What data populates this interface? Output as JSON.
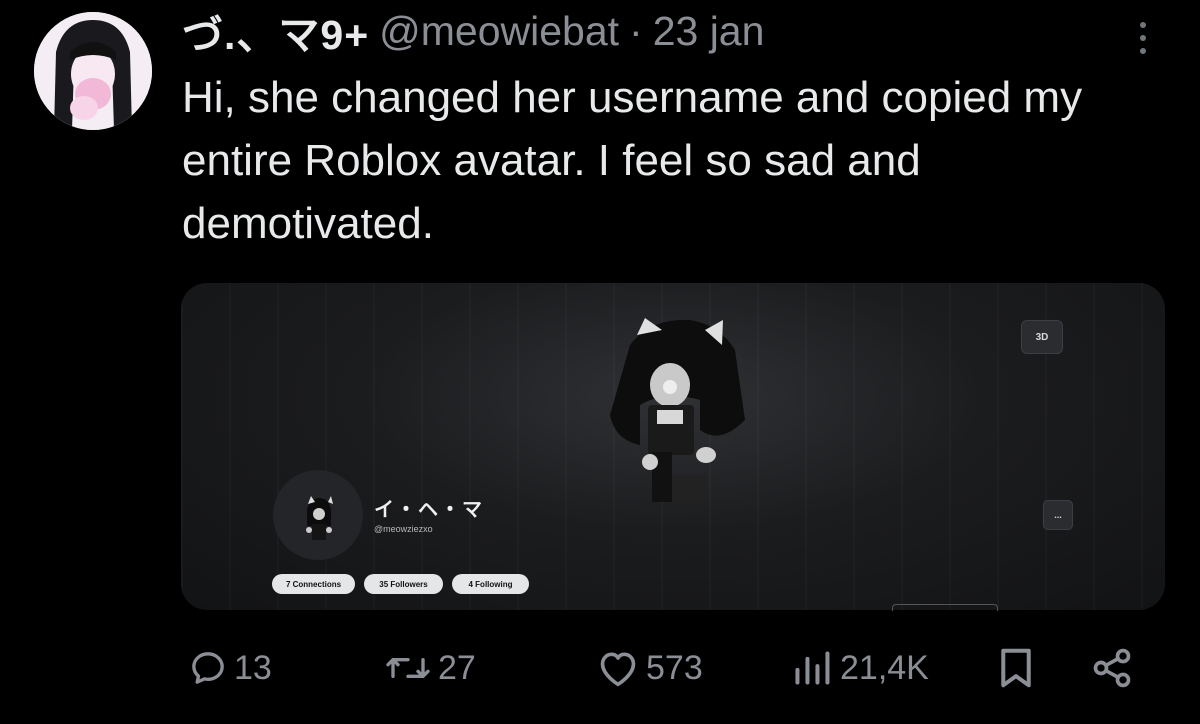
{
  "tweet": {
    "display_name": "づ.、マ9+",
    "handle": "@meowiebat",
    "separator": "·",
    "date": "23 jan",
    "text": "Hi, she changed her username and copied my entire Roblox avatar. I feel so sad and demotivated."
  },
  "media": {
    "button_3d": "3D",
    "more_button": "...",
    "profile": {
      "name": "イ・ヘ・マ",
      "handle": "@meowziezxo",
      "stats": [
        "7 Connections",
        "35 Followers",
        "4 Following"
      ]
    }
  },
  "actions": {
    "replies": "13",
    "reposts": "27",
    "likes": "573",
    "views": "21,4K"
  },
  "icons": {
    "more": "more-vertical-icon",
    "reply": "reply-icon",
    "repost": "repost-icon",
    "like": "heart-icon",
    "views": "views-chart-icon",
    "bookmark": "bookmark-icon",
    "share": "share-icon"
  },
  "colors": {
    "background": "#000000",
    "text": "#e7e9ea",
    "muted": "#8b8f95"
  }
}
